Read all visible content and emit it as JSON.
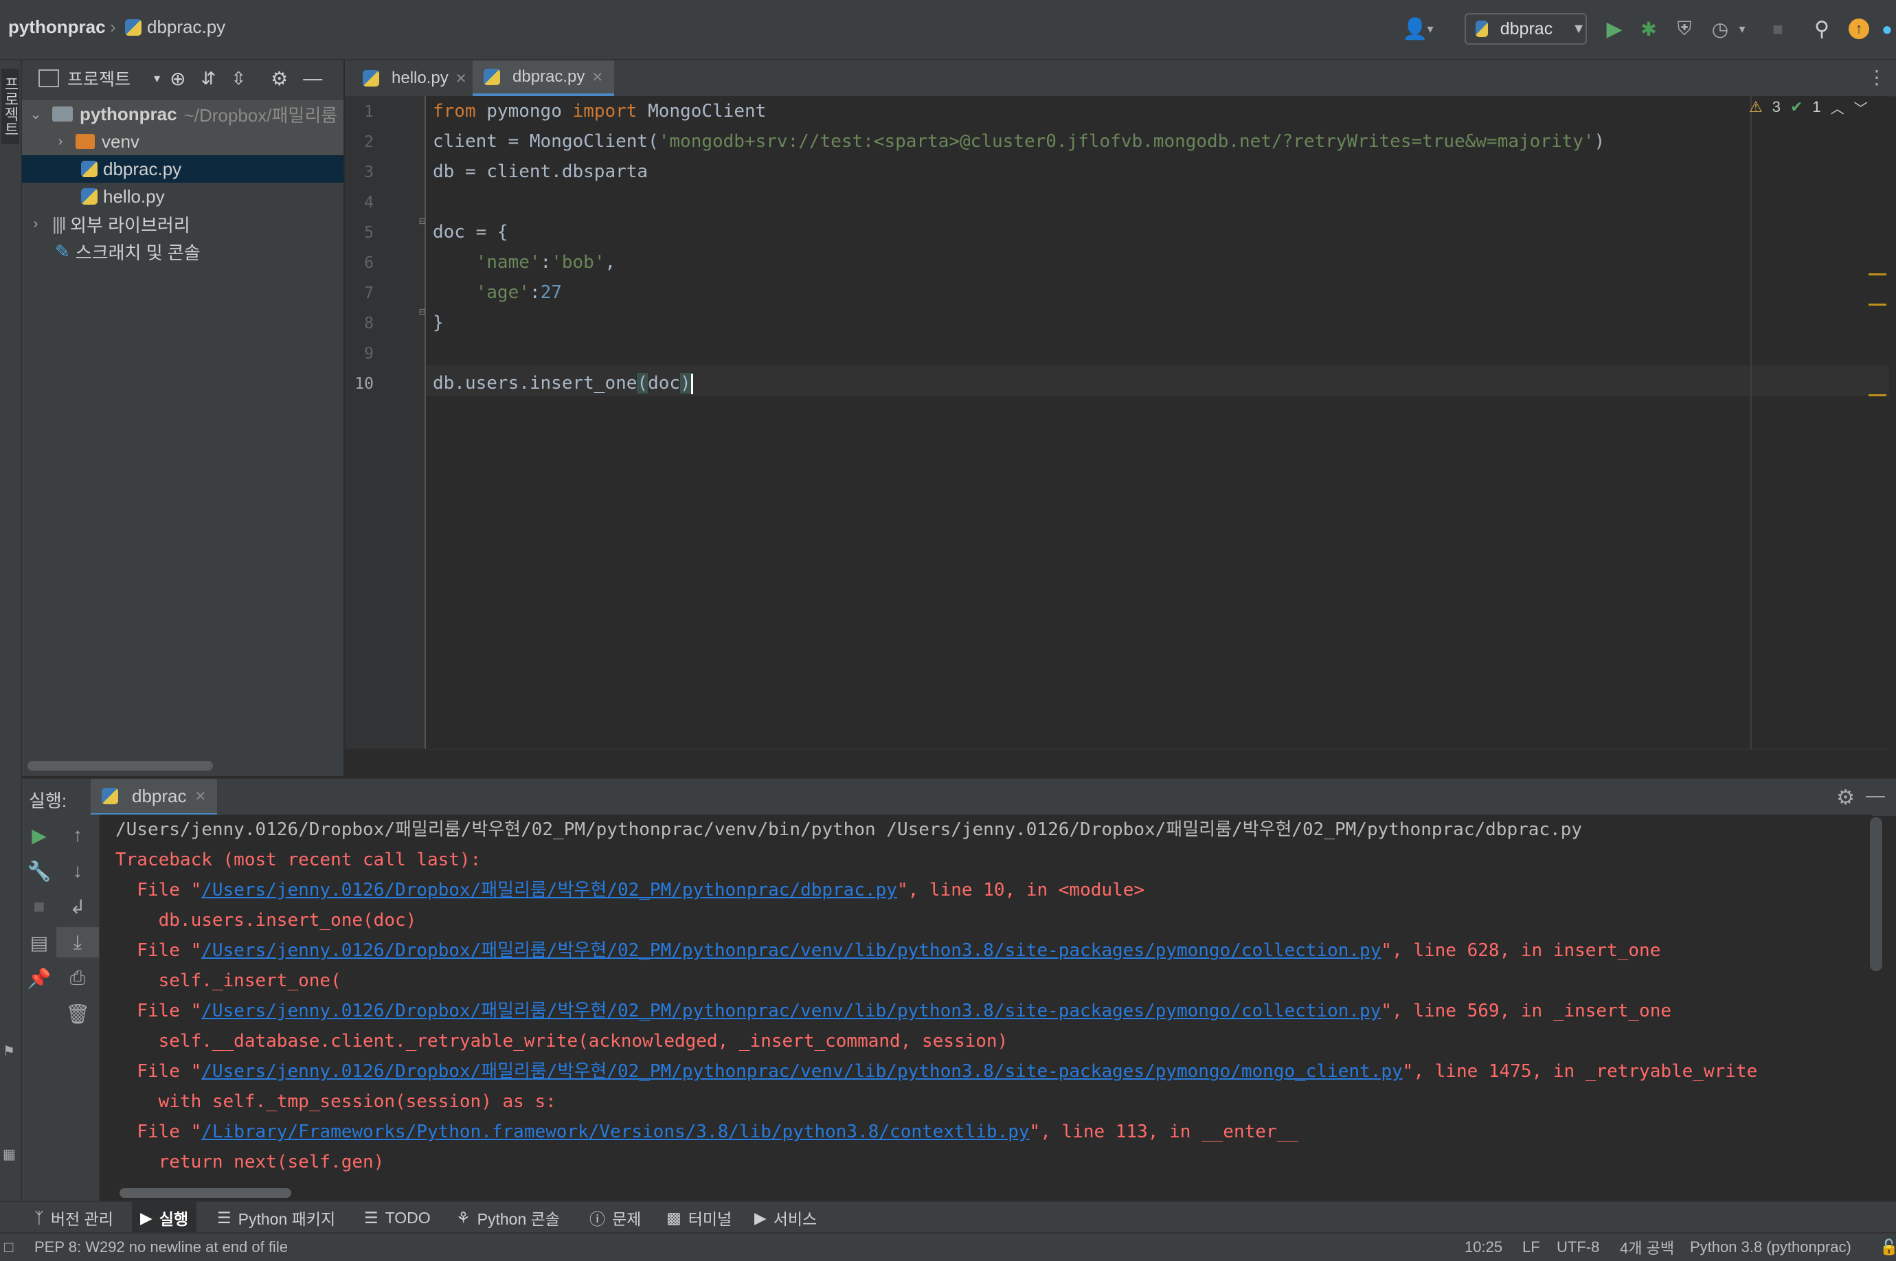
{
  "titlebar": {
    "project": "pythonprac",
    "file": "dbprac.py",
    "run_config": "dbprac"
  },
  "project_panel": {
    "title": "프로젝트",
    "tree": {
      "root_name": "pythonprac",
      "root_path": "~/Dropbox/패밀리룸",
      "venv": "venv",
      "file1": "dbprac.py",
      "file2": "hello.py",
      "ext_libs": "외부 라이브러리",
      "scratches": "스크래치 및 콘솔"
    }
  },
  "editor": {
    "tabs": [
      "hello.py",
      "dbprac.py"
    ],
    "active_tab": "dbprac.py",
    "line_numbers": [
      "1",
      "2",
      "3",
      "4",
      "5",
      "6",
      "7",
      "8",
      "9",
      "10"
    ],
    "current_line": 10,
    "inspections": {
      "warnings": "3",
      "checks": "1"
    },
    "code": {
      "l1_from": "from",
      "l1_mod": " pymongo ",
      "l1_import": "import",
      "l1_rest": " MongoClient",
      "l2_a": "client = MongoClient(",
      "l2_str": "'mongodb+srv://test:<sparta>@cluster0.jflofvb.mongodb.net/?retryWrites=true&w=majority'",
      "l2_b": ")",
      "l3": "db = client.dbsparta",
      "l5": "doc = {",
      "l6_key": "'name'",
      "l6_colon": ":",
      "l6_val": "'bob'",
      "l6_comma": ",",
      "l7_key": "'age'",
      "l7_colon": ":",
      "l7_val": "27",
      "l8": "}",
      "l10_a": "db.users.insert_one",
      "l10_open": "(",
      "l10_arg": "doc",
      "l10_close": ")"
    }
  },
  "run_panel": {
    "label": "실행:",
    "tab": "dbprac",
    "console": {
      "cmd": "/Users/jenny.0126/Dropbox/패밀리룸/박우현/02_PM/pythonprac/venv/bin/python /Users/jenny.0126/Dropbox/패밀리룸/박우현/02_PM/pythonprac/dbprac.py",
      "traceback": "Traceback (most recent call last):",
      "file_prefix": "  File \"",
      "f1_path": "/Users/jenny.0126/Dropbox/패밀리룸/박우현/02_PM/pythonprac/dbprac.py",
      "f1_rest": "\", line 10, in <module>",
      "f1_code": "    db.users.insert_one(doc)",
      "f2_path": "/Users/jenny.0126/Dropbox/패밀리룸/박우현/02_PM/pythonprac/venv/lib/python3.8/site-packages/pymongo/collection.py",
      "f2_rest": "\", line 628, in insert_one",
      "f2_code": "    self._insert_one(",
      "f3_path": "/Users/jenny.0126/Dropbox/패밀리룸/박우현/02_PM/pythonprac/venv/lib/python3.8/site-packages/pymongo/collection.py",
      "f3_rest": "\", line 569, in _insert_one",
      "f3_code": "    self.__database.client._retryable_write(acknowledged, _insert_command, session)",
      "f4_path": "/Users/jenny.0126/Dropbox/패밀리룸/박우현/02_PM/pythonprac/venv/lib/python3.8/site-packages/pymongo/mongo_client.py",
      "f4_rest": "\", line 1475, in _retryable_write",
      "f4_code": "    with self._tmp_session(session) as s:",
      "f5_path": "/Library/Frameworks/Python.framework/Versions/3.8/lib/python3.8/contextlib.py",
      "f5_rest": "\", line 113, in __enter__",
      "f5_code": "    return next(self.gen)"
    }
  },
  "bottom_tools": {
    "vcs": "버전 관리",
    "run": "실행",
    "packages": "Python 패키지",
    "todo": "TODO",
    "console": "Python 콘솔",
    "problems": "문제",
    "terminal": "터미널",
    "services": "서비스"
  },
  "status": {
    "message": "PEP 8: W292 no newline at end of file",
    "position": "10:25",
    "line_sep": "LF",
    "encoding": "UTF-8",
    "indent": "4개 공백",
    "interpreter": "Python 3.8 (pythonprac)"
  },
  "left_stripe": {
    "project": "프로젝트"
  },
  "colors": {
    "keyword": "#cc7832",
    "string": "#6a8759",
    "number": "#6897bb",
    "error": "#ff6b68",
    "link": "#287bde",
    "run_green": "#59a869",
    "debug_green": "#499c54",
    "update_orange": "#f0a732"
  }
}
